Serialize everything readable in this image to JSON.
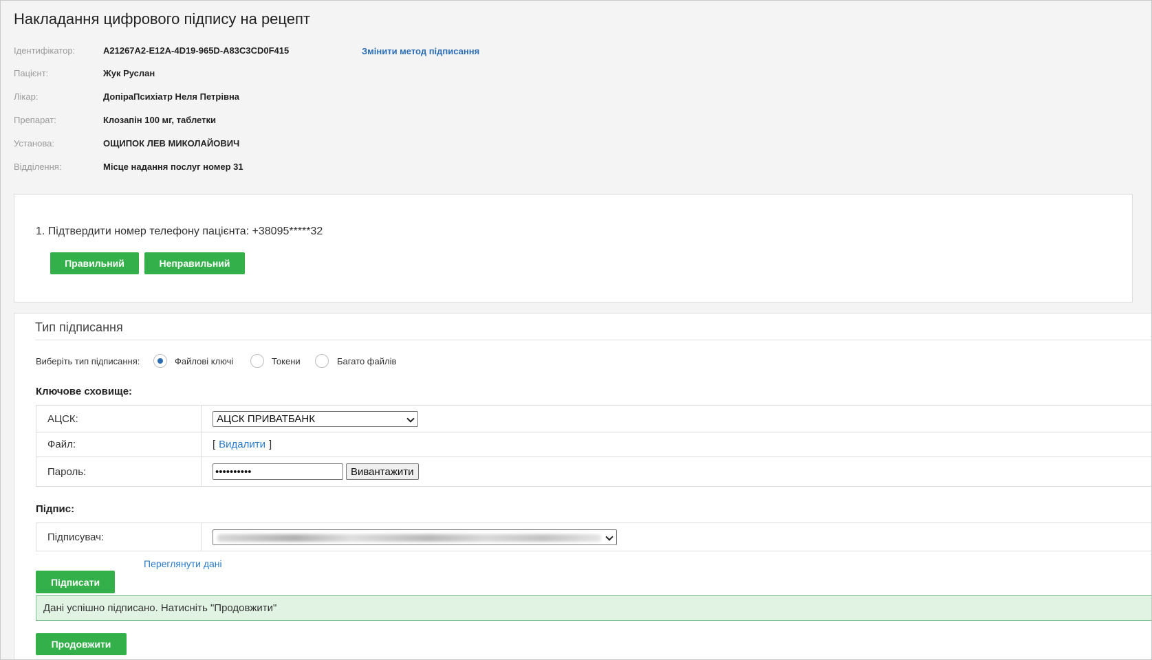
{
  "page": {
    "title": "Накладання цифрового підпису на рецепт"
  },
  "info": {
    "rows": [
      {
        "label": "Ідентифікатор:",
        "value": "A21267A2-E12A-4D19-965D-A83C3CD0F415"
      },
      {
        "label": "Пацієнт:",
        "value": "Жук Руслан"
      },
      {
        "label": "Лікар:",
        "value": "ДопіраПсихіатр Неля Петрівна"
      },
      {
        "label": "Препарат:",
        "value": "Клозапін 100 мг, таблетки"
      },
      {
        "label": "Установа:",
        "value": "ОЩИПОК ЛЕВ МИКОЛАЙОВИЧ"
      },
      {
        "label": "Відділення:",
        "value": "Місце надання послуг номер 31"
      }
    ],
    "change_method_link": "Змінити метод підписання"
  },
  "phone_confirm": {
    "text": "1. Підтвердити номер телефону пацієнта: +38095*****32",
    "correct_button": "Правильний",
    "incorrect_button": "Неправильний"
  },
  "signing": {
    "title": "Тип підписання",
    "choose_label": "Виберіть тип підписання:",
    "options": [
      {
        "label": "Файлові ключі",
        "checked": true
      },
      {
        "label": "Токени",
        "checked": false
      },
      {
        "label": "Багато файлів",
        "checked": false
      }
    ],
    "key_storage": {
      "title": "Ключове сховище:",
      "acsk_label": "АЦСК:",
      "acsk_value": "АЦСК ПРИВАТБАНК",
      "file_label": "Файл:",
      "file_bracket_open": "[",
      "file_delete_link": "Видалити",
      "file_bracket_close": "]",
      "password_label": "Пароль:",
      "password_value": "••••••••••",
      "upload_button": "Вивантажити"
    },
    "signature": {
      "title": "Підпис:",
      "signer_label": "Підписувач:"
    },
    "sign_button": "Підписати",
    "view_data_link": "Переглянути дані",
    "success_message": "Дані успішно підписано. Натисніть \"Продовжити\"",
    "continue_button": "Продовжити"
  },
  "colors": {
    "accent_green": "#34b04a",
    "link_blue": "#2a6db5",
    "success_bg": "#e1f3e3"
  }
}
